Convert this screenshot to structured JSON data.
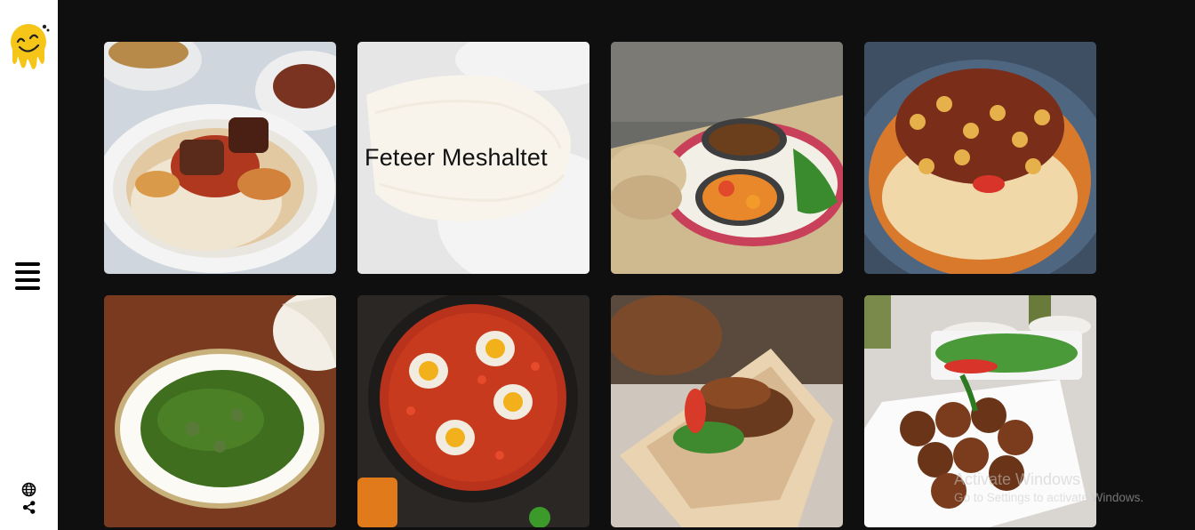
{
  "sidebar": {
    "logo_icon": "smiley-drip-logo",
    "menu_icon": "hamburger-menu-icon",
    "bottom_icons": [
      "globe-icon",
      "share-icon"
    ]
  },
  "cards": [
    {
      "name": "fattah",
      "hover_title": ""
    },
    {
      "name": "feteer-meshaltet",
      "hover_title": "Feteer Meshaltet"
    },
    {
      "name": "foul-and-bread",
      "hover_title": ""
    },
    {
      "name": "koshari",
      "hover_title": ""
    },
    {
      "name": "molokhia",
      "hover_title": ""
    },
    {
      "name": "shakshuka",
      "hover_title": ""
    },
    {
      "name": "shawarma-wrap",
      "hover_title": ""
    },
    {
      "name": "falafel",
      "hover_title": ""
    }
  ],
  "watermark": {
    "line1": "Activate Windows",
    "line2": "Go to Settings to activate Windows."
  },
  "colors": {
    "background": "#0f0f0f",
    "sidebar": "#ffffff",
    "logo_yellow": "#f5c518"
  }
}
